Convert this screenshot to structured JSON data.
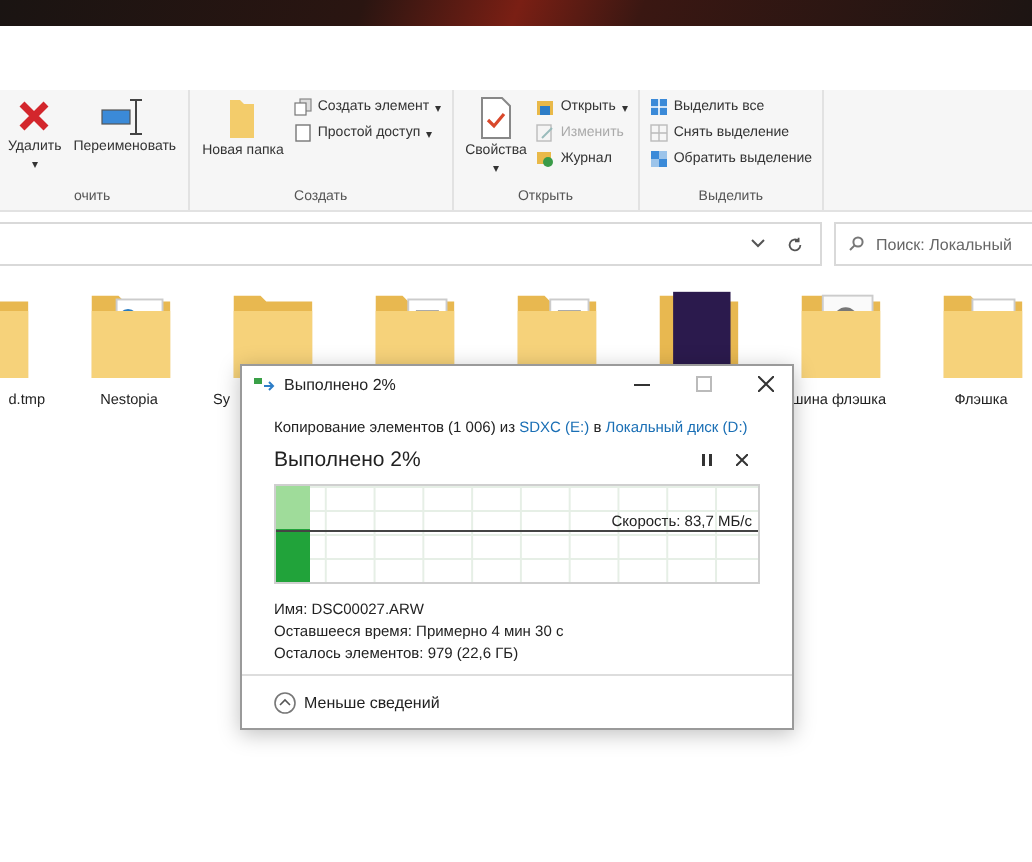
{
  "ribbon": {
    "groups": [
      {
        "label": "очить",
        "items": [
          {
            "kind": "large",
            "label": "Удалить",
            "caret": "▾",
            "disabled": false
          },
          {
            "kind": "large",
            "label": "Переименовать",
            "disabled": false
          }
        ]
      },
      {
        "label": "Создать",
        "items": [
          {
            "kind": "large",
            "label": "Новая папка",
            "disabled": false
          },
          {
            "kind": "small",
            "label": "Создать элемент",
            "caret": "▾",
            "disabled": false
          },
          {
            "kind": "small",
            "label": "Простой доступ",
            "caret": "▾",
            "disabled": false
          }
        ]
      },
      {
        "label": "Открыть",
        "items": [
          {
            "kind": "large",
            "label": "Свойства",
            "caret": "▾",
            "disabled": false
          },
          {
            "kind": "small",
            "label": "Открыть",
            "caret": "▾",
            "disabled": false
          },
          {
            "kind": "small",
            "label": "Изменить",
            "disabled": true
          },
          {
            "kind": "small",
            "label": "Журнал",
            "disabled": false
          }
        ]
      },
      {
        "label": "Выделить",
        "items": [
          {
            "kind": "small",
            "label": "Выделить все",
            "disabled": false
          },
          {
            "kind": "small",
            "label": "Снять выделение",
            "disabled": false
          },
          {
            "kind": "small",
            "label": "Обратить выделение",
            "disabled": false
          }
        ]
      }
    ]
  },
  "search": {
    "placeholder": "Поиск: Локальный"
  },
  "files": [
    {
      "kind": "blank_cut",
      "name": "d.tmp"
    },
    {
      "kind": "doc",
      "name": "Nestopia"
    },
    {
      "kind": "blank_wrapped",
      "name": "Sy"
    },
    {
      "kind": "docs"
    },
    {
      "kind": "docs"
    },
    {
      "kind": "image"
    },
    {
      "kind": "photo",
      "name": "шина флэшка"
    },
    {
      "kind": "pdf",
      "name": "Флэшка"
    }
  ],
  "dialog": {
    "title": "Выполнено 2%",
    "summary": {
      "before": "Копирование элементов (1 006) из ",
      "source": "SDXC (E:)",
      "middle": " в ",
      "target": "Локальный диск (D:)"
    },
    "heading": "Выполнено 2%",
    "level": 0.02,
    "speed": "Скорость: 83,7 МБ/с",
    "details": [
      "Имя:  DSC00027.ARW",
      "Оставшееся время:  Примерно 4 мин 30 с",
      "Осталось элементов:  979 (22,6 ГБ)"
    ],
    "toggle": "Меньше сведений"
  }
}
